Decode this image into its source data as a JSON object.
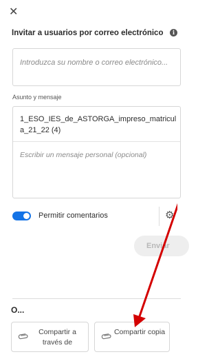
{
  "header": {
    "close_glyph": "✕",
    "title": "Invitar a usuarios por correo electrónico",
    "info_glyph": "i"
  },
  "email": {
    "placeholder": "Introduzca su nombre o correo electrónico..."
  },
  "subject_section": {
    "label": "Asunto y mensaje",
    "subject_value": "1_ESO_IES_de_ASTORGA_impreso_matricula_21_22 (4)",
    "message_placeholder": "Escribir un mensaje personal (opcional)"
  },
  "comments": {
    "toggle_on": true,
    "label": "Permitir comentarios"
  },
  "settings": {
    "gear_glyph": "⚙"
  },
  "send": {
    "label": "Enviar"
  },
  "share": {
    "heading": "O...",
    "clip_glyph": "⌀",
    "options": [
      {
        "label": "Compartir a través de"
      },
      {
        "label": "Compartir copia"
      }
    ]
  },
  "colors": {
    "accent": "#1473e6",
    "annotation_arrow": "#d40000"
  }
}
